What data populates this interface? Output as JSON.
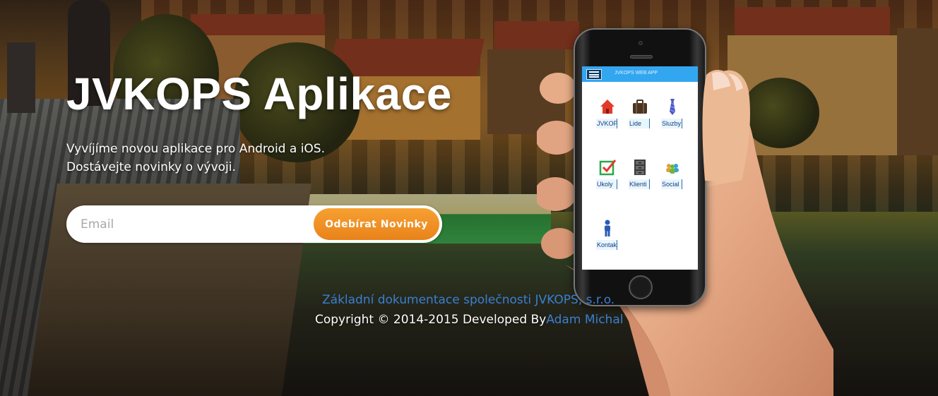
{
  "hero": {
    "title": "JVKOPS Aplikace",
    "subtitle_line1": "Vyvíjíme novou aplikace pro Android a iOS.",
    "subtitle_line2": "Dostávejte novinky o vývoji."
  },
  "subscribe": {
    "email_placeholder": "Email",
    "button_label": "Odebírat Novinky"
  },
  "footer": {
    "doc_link": "Základní dokumentace společnosti JVKOPS, s.r.o.",
    "copyright": "Copyright © 2014-2015 Developed By",
    "author_link": "Adam Michal"
  },
  "phone_app": {
    "title": "JVKOPS WEB APP",
    "tiles": [
      {
        "label": "JVKOPS",
        "icon": "house-icon",
        "color": "#e23a2a"
      },
      {
        "label": "Lide",
        "icon": "briefcase-icon",
        "color": "#4a3424"
      },
      {
        "label": "Sluzby",
        "icon": "tie-icon",
        "color": "#4a5ac8"
      },
      {
        "label": "Ukoly",
        "icon": "checkbox-icon",
        "color": "#2aa84a"
      },
      {
        "label": "Klienti",
        "icon": "file-cabinet-icon",
        "color": "#3a3a3a"
      },
      {
        "label": "Social",
        "icon": "people-icon",
        "color": "#e0a03a"
      },
      {
        "label": "Kontakt",
        "icon": "person-icon",
        "color": "#2a5ab8"
      }
    ]
  },
  "colors": {
    "accent_orange": "#f7a032",
    "link_blue": "#3b7fd1",
    "app_bar_blue": "#33a6f0"
  }
}
